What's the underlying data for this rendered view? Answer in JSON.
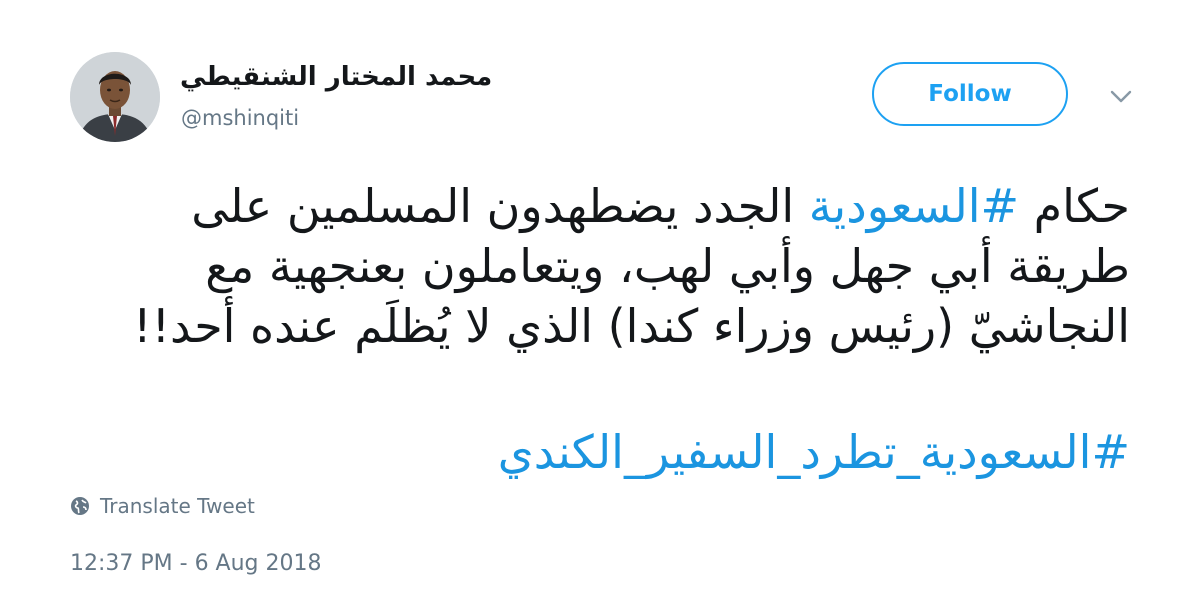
{
  "user": {
    "display_name": "محمد المختار الشنقيطي",
    "handle": "@mshinqiti",
    "avatar_icon": "profile-photo"
  },
  "follow_label": "Follow",
  "more_icon": "chevron-down-icon",
  "tweet": {
    "lines": [
      [
        {
          "text": "حكام ",
          "hashtag": false
        },
        {
          "text": "#السعودية",
          "hashtag": true
        },
        {
          "text": " الجدد يضطهدون المسلمين على",
          "hashtag": false
        }
      ],
      [
        {
          "text": "طريقة أبي جهل وأبي لهب، ويتعاملون بعنجهية مع",
          "hashtag": false
        }
      ],
      [
        {
          "text": "النجاشيّ (رئيس وزراء كندا) الذي لا يُظلَم عنده أحد!!",
          "hashtag": false
        }
      ]
    ],
    "hashtag_line": "#السعودية_تطرد_السفير_الكندي"
  },
  "translate_label": "Translate Tweet",
  "translate_icon": "globe-icon",
  "timestamp": "12:37 PM - 6 Aug 2018",
  "colors": {
    "accent": "#1da1f2",
    "hashtag": "#1b95e0",
    "text": "#14171a",
    "muted": "#657786"
  }
}
